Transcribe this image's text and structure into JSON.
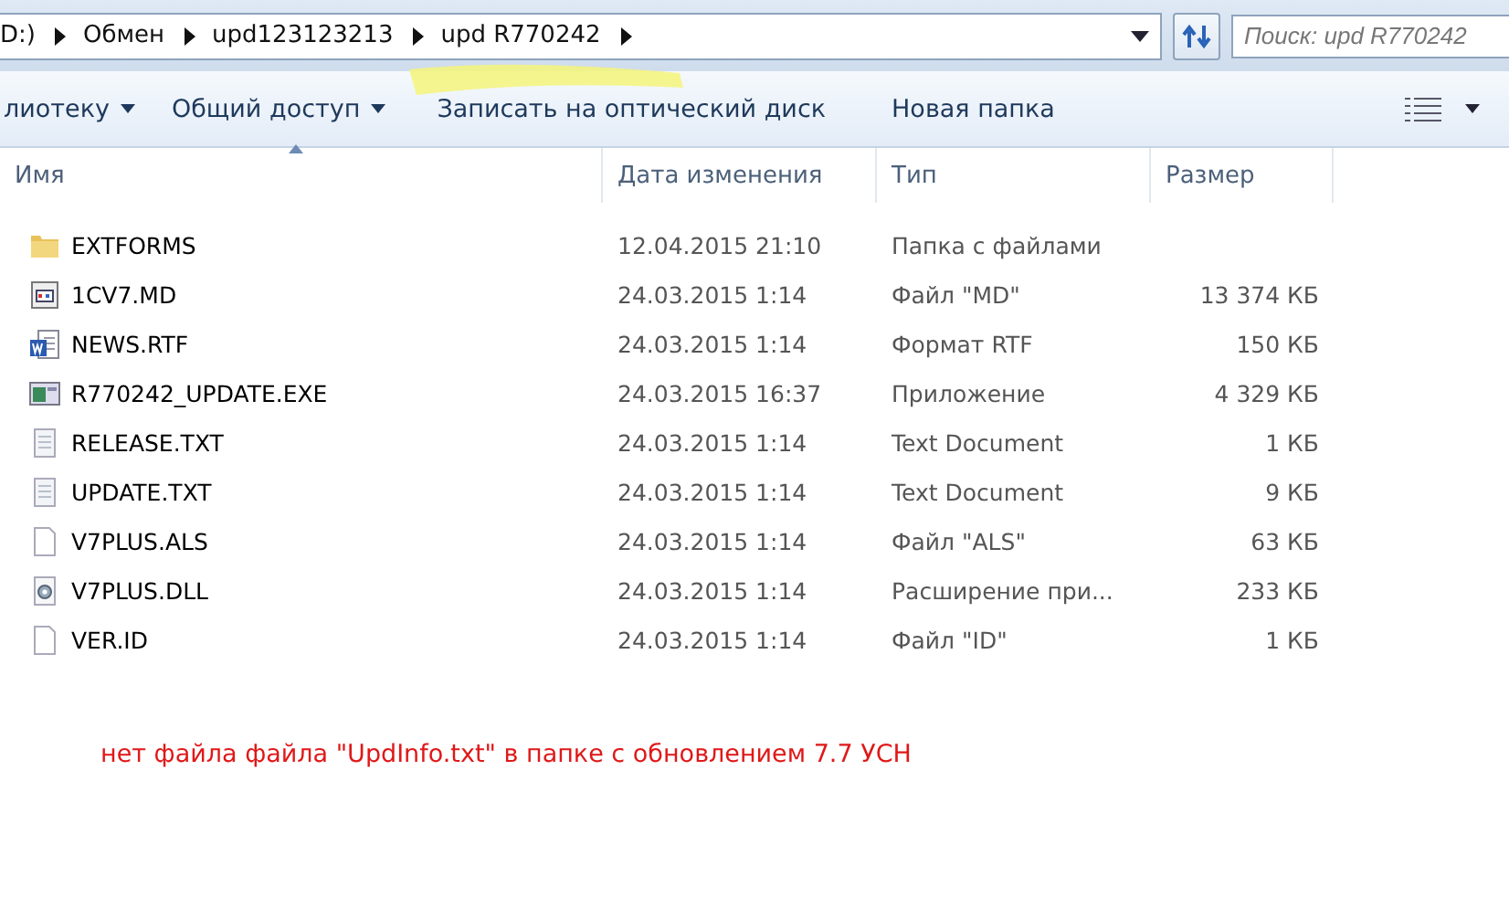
{
  "address_bar": {
    "crumbs": [
      "D:)",
      "Обмен",
      "upd123123213",
      "upd R770242"
    ]
  },
  "search": {
    "placeholder": "Поиск: upd R770242"
  },
  "toolbar": {
    "items": [
      {
        "label": "лиотеку",
        "dropdown": true
      },
      {
        "label": "Общий доступ",
        "dropdown": true
      },
      {
        "label": "Записать на оптический диск",
        "dropdown": false
      },
      {
        "label": "Новая папка",
        "dropdown": false
      }
    ]
  },
  "table": {
    "columns": [
      {
        "label": "Имя",
        "sorted": true
      },
      {
        "label": "Дата изменения",
        "sorted": false
      },
      {
        "label": "Тип",
        "sorted": false
      },
      {
        "label": "Размер",
        "sorted": false
      }
    ],
    "rows": [
      {
        "kind": "folder",
        "name": "EXTFORMS",
        "date": "12.04.2015 21:10",
        "type": "Папка с файлами"
      },
      {
        "kind": "md",
        "name": "1CV7.MD",
        "date": "24.03.2015 1:14",
        "type": "Файл \"MD\"",
        "size": "13 374 КБ"
      },
      {
        "kind": "word",
        "name": "NEWS.RTF",
        "date": "24.03.2015 1:14",
        "type": "Формат RTF",
        "size": "150 КБ"
      },
      {
        "kind": "exe",
        "name": "R770242_UPDATE.EXE",
        "date": "24.03.2015 16:37",
        "type": "Приложение",
        "size": "4 329 КБ"
      },
      {
        "kind": "text",
        "name": "RELEASE.TXT",
        "date": "24.03.2015 1:14",
        "type": "Text Document",
        "size": "1 КБ"
      },
      {
        "kind": "text",
        "name": "UPDATE.TXT",
        "date": "24.03.2015 1:14",
        "type": "Text Document",
        "size": "9 КБ"
      },
      {
        "kind": "blank",
        "name": "V7PLUS.ALS",
        "date": "24.03.2015 1:14",
        "type": "Файл \"ALS\"",
        "size": "63 КБ"
      },
      {
        "kind": "dll",
        "name": "V7PLUS.DLL",
        "date": "24.03.2015 1:14",
        "type": "Расширение при...",
        "size": "233 КБ"
      },
      {
        "kind": "blank",
        "name": "VER.ID",
        "date": "24.03.2015 1:14",
        "type": "Файл \"ID\"",
        "size": "1 КБ"
      }
    ]
  },
  "note": "нет файла файла \"UpdInfo.txt\" в папке с обновлением 7.7 УСН"
}
